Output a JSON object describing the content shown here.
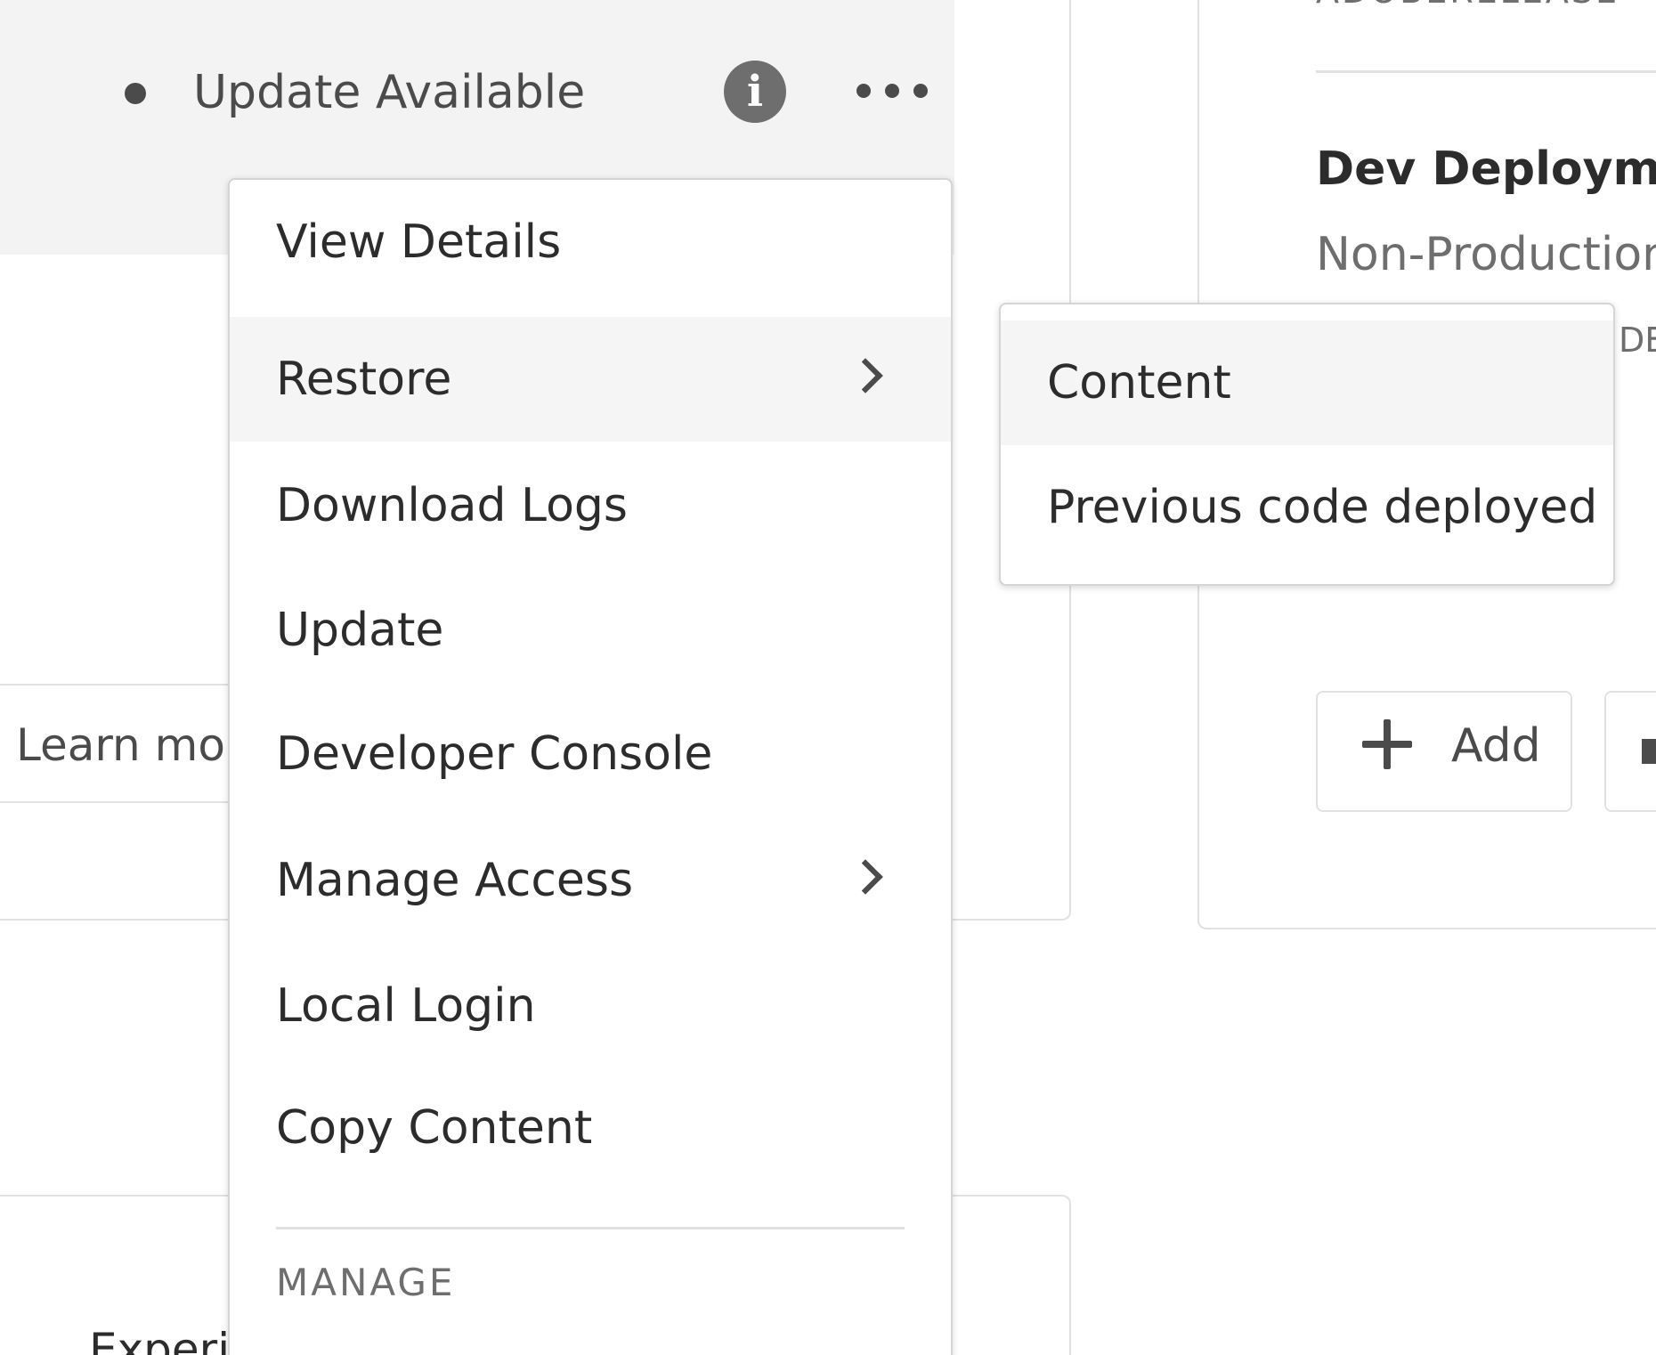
{
  "environment": {
    "status": "Update Available",
    "learn_more": "Learn mo",
    "bottom_card_text": "Experi"
  },
  "pipeline": {
    "release_label": "ADOBERELEASE",
    "title": "Dev Deployment",
    "subtitle": "Non-Production",
    "tag": "DE",
    "add_label": "Add"
  },
  "menu": {
    "items": [
      {
        "label": "View Details",
        "has_submenu": false
      },
      {
        "label": "Restore",
        "has_submenu": true
      },
      {
        "label": "Download Logs",
        "has_submenu": false
      },
      {
        "label": "Update",
        "has_submenu": false
      },
      {
        "label": "Developer Console",
        "has_submenu": false
      },
      {
        "label": "Manage Access",
        "has_submenu": true
      },
      {
        "label": "Local Login",
        "has_submenu": false
      },
      {
        "label": "Copy Content",
        "has_submenu": false
      }
    ],
    "section_label": "MANAGE",
    "highlighted_item": "Restore"
  },
  "submenu": {
    "items": [
      {
        "label": "Content"
      },
      {
        "label": "Previous code deployed"
      }
    ]
  },
  "colors": {
    "highlight": "#f5f5f5",
    "text": "#2c2c2c",
    "muted": "#6e6e6e",
    "border": "#e1e1e1"
  },
  "icons": {
    "status": "dot-icon",
    "info": "info-icon",
    "more": "more-horizontal-icon",
    "submenu": "chevron-right-icon",
    "add": "plus-icon"
  }
}
